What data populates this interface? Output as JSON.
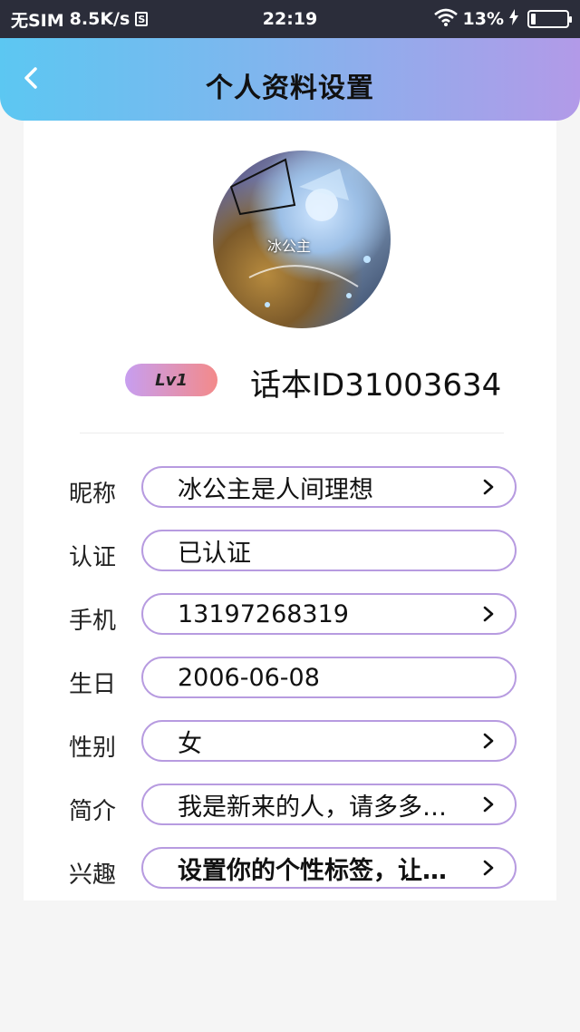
{
  "status_bar": {
    "carrier": "无SIM",
    "speed": "8.5K/s",
    "s_badge": "S",
    "time": "22:19",
    "battery_percent": "13%",
    "battery_level": 0.13
  },
  "header": {
    "title": "个人资料设置"
  },
  "profile": {
    "avatar_caption": "冰公主",
    "level": "Lv1",
    "user_id": "话本ID31003634"
  },
  "fields": [
    {
      "label": "昵称",
      "value": "冰公主是人间理想",
      "has_arrow": true
    },
    {
      "label": "认证",
      "value": "已认证",
      "has_arrow": false
    },
    {
      "label": "手机",
      "value": "13197268319",
      "has_arrow": true
    },
    {
      "label": "生日",
      "value": "2006-06-08",
      "has_arrow": false
    },
    {
      "label": "性别",
      "value": "女",
      "has_arrow": true
    },
    {
      "label": "简介",
      "value": "我是新来的人，请多多…",
      "has_arrow": true
    },
    {
      "label": "兴趣",
      "value": "设置你的个性标签，让…",
      "has_arrow": true
    }
  ],
  "colors": {
    "header_start": "#5cc7f2",
    "header_end": "#b29ae8",
    "pill_border": "#b79be0",
    "status_bar": "#2b2d3a"
  },
  "icons": {
    "back": "chevron-left-icon",
    "row_arrow": "chevron-right-icon",
    "wifi": "wifi-icon",
    "charging": "lightning-icon",
    "battery": "battery-icon"
  }
}
